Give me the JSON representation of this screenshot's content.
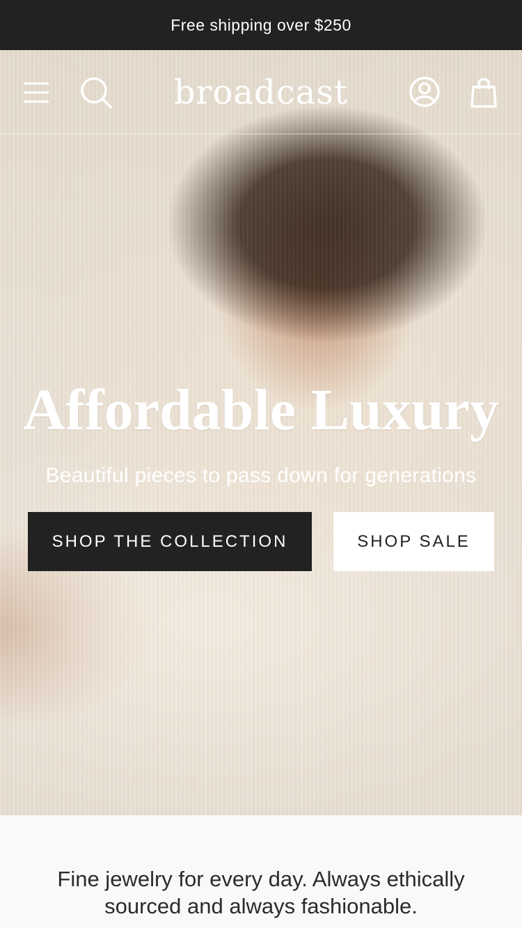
{
  "announcement": {
    "text": "Free shipping over $250"
  },
  "header": {
    "logo_text": "broadcast",
    "icons": {
      "menu": "hamburger-menu-icon",
      "search": "search-icon",
      "account": "account-icon",
      "cart": "shopping-bag-icon"
    }
  },
  "hero": {
    "title": "Affordable Luxury",
    "subtitle": "Beautiful pieces to pass down for generations",
    "primary_button": "SHOP THE COLLECTION",
    "secondary_button": "SHOP SALE"
  },
  "intro": {
    "text": "Fine jewelry for every day. Always ethically sourced and always fashionable."
  },
  "colors": {
    "dark": "#222222",
    "light": "#ffffff",
    "page_background": "#faf9f7"
  }
}
